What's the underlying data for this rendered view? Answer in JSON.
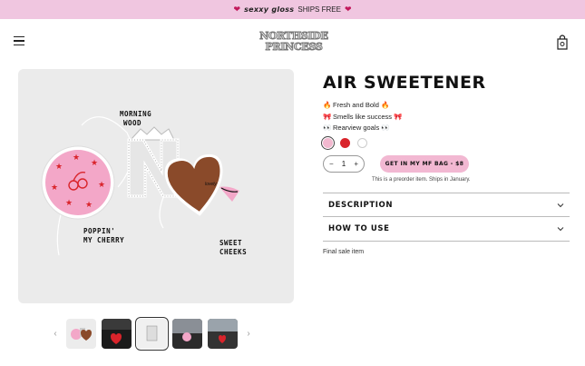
{
  "announcement": {
    "gem_icon": "heart-gem-icon",
    "brand": "sexxy gloss",
    "text": "SHIPS FREE"
  },
  "header": {
    "logo_line1": "NORTHSIDE",
    "logo_line2": "PRINCESS",
    "menu_icon": "hamburger-icon",
    "bag_icon": "shopping-bag-icon"
  },
  "gallery": {
    "labels": {
      "morning1": "MORNING",
      "morning2": "WOOD",
      "cherry1": "POPPIN'",
      "cherry2": "MY CHERRY",
      "sweet1": "SWEET",
      "sweet2": "CHEEKS"
    },
    "prev_arrow": "‹",
    "next_arrow": "›"
  },
  "product": {
    "title": "AIR SWEETENER",
    "bullets": [
      {
        "icon": "🔥",
        "text": "Fresh and Bold",
        "icon_end": "🔥"
      },
      {
        "icon": "🎀",
        "text": "Smells like success",
        "icon_end": "🎀"
      },
      {
        "icon": "👀",
        "text": "Rearview goals",
        "icon_end": "👀"
      }
    ],
    "swatches": [
      "#f2b8cf",
      "#d9242b",
      "#ffffff"
    ],
    "quantity": {
      "minus": "−",
      "value": "1",
      "plus": "+"
    },
    "cta": "GET IN MY MF BAG - $8",
    "preorder_note": "This is a preorder item. Ships in January.",
    "accordion": [
      {
        "label": "DESCRIPTION"
      },
      {
        "label": "HOW TO USE"
      }
    ],
    "final_note": "Final sale item"
  }
}
